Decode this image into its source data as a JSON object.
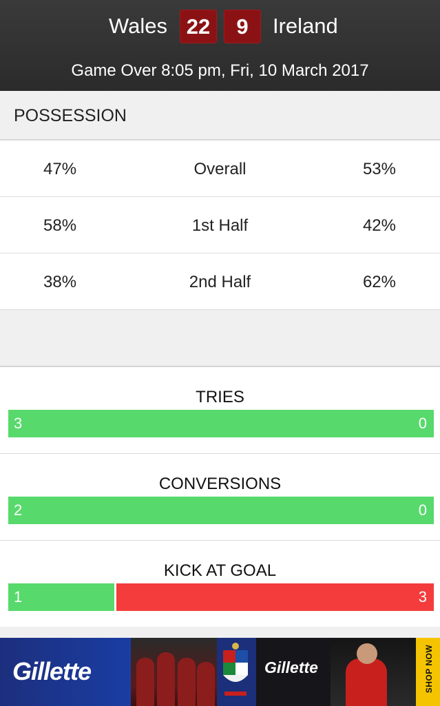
{
  "header": {
    "home_team": "Wales",
    "home_score": "22",
    "away_score": "9",
    "away_team": "Ireland",
    "status": "Game Over  8:05 pm, Fri, 10 March 2017"
  },
  "possession": {
    "title": "POSSESSION",
    "rows": [
      {
        "home": "47%",
        "label": "Overall",
        "away": "53%"
      },
      {
        "home": "58%",
        "label": "1st Half",
        "away": "42%"
      },
      {
        "home": "38%",
        "label": "2nd Half",
        "away": "62%"
      }
    ]
  },
  "stats": [
    {
      "label": "TRIES",
      "home": "3",
      "away": "0",
      "home_share": 1.0
    },
    {
      "label": "CONVERSIONS",
      "home": "2",
      "away": "0",
      "home_share": 1.0
    },
    {
      "label": "KICK AT GOAL",
      "home": "1",
      "away": "3",
      "home_share": 0.25
    }
  ],
  "colors": {
    "home_bar": "#57d96b",
    "away_bar": "#f43c3c",
    "score_box": "#8b1214",
    "header_bg": "#2f2f2f"
  },
  "ad": {
    "brand_left": "Gillette",
    "brand_mid": "Gillette",
    "cta": "SHOP NOW"
  }
}
